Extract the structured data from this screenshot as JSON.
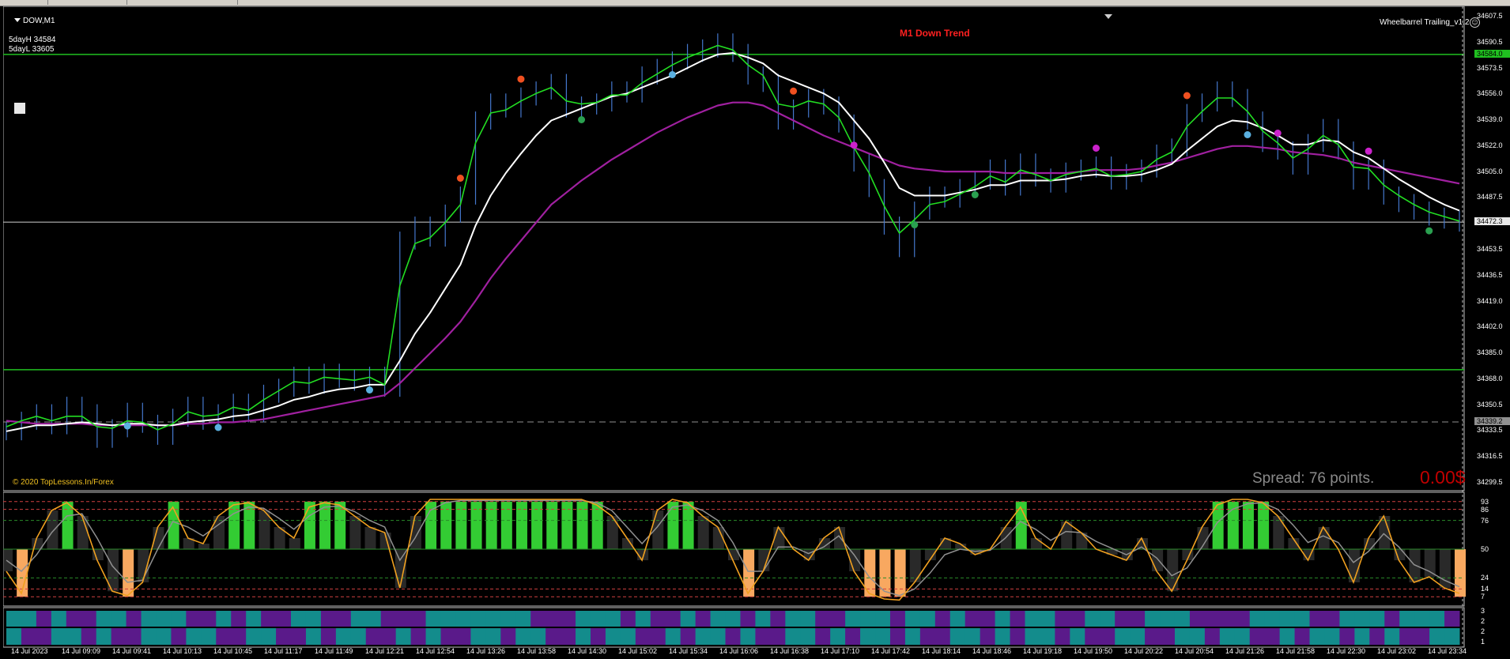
{
  "window": {
    "symbol_label": "DOW,M1",
    "five_day_high": "5dayH 34584",
    "five_day_low": "5dayL 33605",
    "trend_label": "M1 Down Trend",
    "indicator_name": "Wheelbarrel Trailing_v1.2",
    "copyright": "© 2020 TopLessons.In/Forex",
    "spread_text": "Spread: 76 points.",
    "profit_text": "0.00$"
  },
  "colors": {
    "background": "#000000",
    "ema_fast": "#22dd22",
    "ema_mid": "#ffffff",
    "ema_slow": "#a020a0",
    "price_bars": "#4477cc",
    "level_line": "#20c020",
    "osc_line": "#f0a020",
    "osc_fill_high": "#33cc33",
    "osc_fill_low": "#f8a860",
    "hist_teal": "#138c8c",
    "hist_purple": "#5a1a8a"
  },
  "price_axis": {
    "labels": [
      "34607.5",
      "34590.5",
      "34573.5",
      "34556.0",
      "34539.0",
      "34522.0",
      "34505.0",
      "34487.5",
      "34470.5",
      "34453.5",
      "34436.5",
      "34419.0",
      "34402.0",
      "34385.0",
      "34368.0",
      "34350.5",
      "34333.5",
      "34316.5",
      "34299.5"
    ],
    "box_labels": [
      {
        "text": "34584.0",
        "color": "#20c020",
        "value": 34584
      },
      {
        "text": "34472.3",
        "color": "#e8e8e8",
        "value": 34472.3
      },
      {
        "text": "34339.2",
        "color": "#909090",
        "value": 34339.2
      }
    ]
  },
  "oscillator_axis": {
    "labels": [
      "93",
      "86",
      "76",
      "50",
      "24",
      "14",
      "7"
    ],
    "levels": [
      93,
      86,
      76,
      50,
      24,
      14,
      7
    ]
  },
  "histogram_axis": {
    "labels": [
      "3",
      "2",
      "2",
      "1"
    ]
  },
  "time_axis": {
    "labels": [
      "14 Jul 2023",
      "14 Jul 09:09",
      "14 Jul 09:41",
      "14 Jul 10:13",
      "14 Jul 10:45",
      "14 Jul 11:17",
      "14 Jul 11:49",
      "14 Jul 12:21",
      "14 Jul 12:54",
      "14 Jul 13:26",
      "14 Jul 13:58",
      "14 Jul 14:30",
      "14 Jul 15:02",
      "14 Jul 15:34",
      "14 Jul 16:06",
      "14 Jul 16:38",
      "14 Jul 17:10",
      "14 Jul 17:42",
      "14 Jul 18:14",
      "14 Jul 18:46",
      "14 Jul 19:18",
      "14 Jul 19:50",
      "14 Jul 20:22",
      "14 Jul 20:54",
      "14 Jul 21:26",
      "14 Jul 21:58",
      "14 Jul 22:30",
      "14 Jul 23:02",
      "14 Jul 23:34"
    ]
  },
  "levels": {
    "five_day_high": 34584,
    "current_price": 34472.3,
    "breakout_level": 34374,
    "dashed_level": 34339.2
  },
  "series": {
    "price_close": [
      34333,
      34340,
      34345,
      34337,
      34350,
      34345,
      34328,
      34335,
      34346,
      34338,
      34330,
      34342,
      34350,
      34340,
      34345,
      34352,
      34345,
      34358,
      34362,
      34370,
      34364,
      34372,
      34368,
      34366,
      34370,
      34362,
      34460,
      34470,
      34462,
      34478,
      34490,
      34540,
      34552,
      34548,
      34556,
      34560,
      34565,
      34548,
      34550,
      34552,
      34560,
      34558,
      34570,
      34575,
      34580,
      34585,
      34588,
      34592,
      34585,
      34570,
      34565,
      34540,
      34548,
      34555,
      34550,
      34538,
      34512,
      34495,
      34470,
      34455,
      34480,
      34490,
      34488,
      34495,
      34500,
      34508,
      34496,
      34512,
      34502,
      34498,
      34506,
      34508,
      34510,
      34500,
      34505,
      34508,
      34518,
      34522,
      34545,
      34552,
      34560,
      34555,
      34540,
      34525,
      34520,
      34510,
      34525,
      34535,
      34520,
      34500,
      34508,
      34490,
      34485,
      34480,
      34476,
      34474,
      34472
    ],
    "ema_fast": [
      34336,
      34340,
      34343,
      34340,
      34343,
      34343,
      34336,
      34335,
      34340,
      34339,
      34334,
      34338,
      34346,
      34343,
      34344,
      34349,
      34347,
      34354,
      34360,
      34366,
      34365,
      34369,
      34368,
      34367,
      34369,
      34364,
      34430,
      34458,
      34462,
      34472,
      34484,
      34525,
      34545,
      34547,
      34553,
      34558,
      34562,
      34553,
      34551,
      34552,
      34557,
      34557,
      34565,
      34571,
      34577,
      34582,
      34586,
      34590,
      34587,
      34577,
      34570,
      34551,
      34549,
      34553,
      34551,
      34542,
      34522,
      34505,
      34483,
      34465,
      34474,
      34484,
      34486,
      34491,
      34496,
      34503,
      34499,
      34507,
      34504,
      34500,
      34504,
      34506,
      34508,
      34503,
      34504,
      34506,
      34514,
      34519,
      34536,
      34546,
      34555,
      34555,
      34546,
      34533,
      34525,
      34515,
      34521,
      34530,
      34524,
      34509,
      34508,
      34497,
      34490,
      34484,
      34479,
      34476,
      34473
    ],
    "ema_mid": [
      34333,
      34335,
      34337,
      34337,
      34338,
      34339,
      34338,
      34337,
      34338,
      34338,
      34337,
      34337,
      34339,
      34340,
      34341,
      34343,
      34344,
      34347,
      34350,
      34354,
      34356,
      34359,
      34361,
      34362,
      34364,
      34364,
      34380,
      34398,
      34412,
      34428,
      34444,
      34470,
      34490,
      34505,
      34518,
      34530,
      34540,
      34544,
      34548,
      34552,
      34556,
      34558,
      34562,
      34566,
      34570,
      34575,
      34580,
      34584,
      34585,
      34582,
      34578,
      34570,
      34566,
      34562,
      34558,
      34552,
      34540,
      34528,
      34512,
      34495,
      34490,
      34490,
      34490,
      34492,
      34494,
      34497,
      34497,
      34500,
      34500,
      34500,
      34501,
      34503,
      34504,
      34503,
      34503,
      34504,
      34507,
      34511,
      34520,
      34528,
      34536,
      34540,
      34539,
      34535,
      34530,
      34524,
      34524,
      34527,
      34526,
      34519,
      34515,
      34508,
      34501,
      34495,
      34489,
      34484,
      34480
    ],
    "ema_slow": [
      34340,
      34339,
      34338,
      34338,
      34338,
      34338,
      34337,
      34337,
      34337,
      34337,
      34337,
      34337,
      34338,
      34338,
      34339,
      34339,
      34340,
      34341,
      34343,
      34345,
      34347,
      34349,
      34351,
      34353,
      34355,
      34357,
      34365,
      34375,
      34385,
      34395,
      34406,
      34420,
      34435,
      34448,
      34460,
      34472,
      34484,
      34492,
      34500,
      34507,
      34514,
      34520,
      34526,
      34532,
      34537,
      34542,
      34546,
      34550,
      34552,
      34552,
      34550,
      34545,
      34540,
      34535,
      34530,
      34526,
      34522,
      34518,
      34514,
      34510,
      34508,
      34507,
      34506,
      34506,
      34506,
      34506,
      34505,
      34505,
      34505,
      34505,
      34505,
      34506,
      34507,
      34507,
      34507,
      34508,
      34510,
      34512,
      34515,
      34518,
      34521,
      34523,
      34523,
      34522,
      34521,
      34519,
      34518,
      34517,
      34515,
      34512,
      34510,
      34508,
      34506,
      34504,
      34502,
      34500,
      34498
    ],
    "oscillator": [
      30,
      10,
      60,
      85,
      92,
      80,
      40,
      12,
      8,
      20,
      70,
      88,
      60,
      55,
      80,
      90,
      92,
      85,
      70,
      60,
      88,
      92,
      90,
      80,
      70,
      65,
      15,
      80,
      95,
      95,
      95,
      95,
      95,
      95,
      95,
      95,
      95,
      95,
      95,
      90,
      80,
      60,
      40,
      85,
      95,
      92,
      80,
      70,
      40,
      10,
      30,
      70,
      50,
      40,
      60,
      70,
      30,
      10,
      5,
      4,
      20,
      40,
      60,
      55,
      45,
      50,
      70,
      88,
      60,
      50,
      75,
      65,
      50,
      45,
      40,
      60,
      30,
      12,
      40,
      70,
      90,
      95,
      95,
      92,
      80,
      60,
      40,
      70,
      50,
      20,
      60,
      80,
      40,
      20,
      25,
      15,
      10
    ],
    "oscillator_signal": [
      40,
      30,
      45,
      65,
      80,
      82,
      60,
      35,
      20,
      22,
      50,
      75,
      70,
      62,
      72,
      82,
      88,
      87,
      78,
      68,
      80,
      88,
      89,
      84,
      76,
      70,
      40,
      60,
      85,
      92,
      94,
      94,
      94,
      94,
      94,
      94,
      94,
      94,
      94,
      92,
      85,
      70,
      55,
      70,
      88,
      90,
      85,
      76,
      56,
      30,
      30,
      52,
      52,
      46,
      52,
      62,
      45,
      25,
      12,
      8,
      14,
      28,
      45,
      50,
      48,
      49,
      60,
      75,
      68,
      58,
      66,
      65,
      57,
      51,
      45,
      52,
      42,
      26,
      33,
      52,
      74,
      86,
      91,
      92,
      86,
      72,
      56,
      62,
      56,
      38,
      48,
      64,
      52,
      36,
      30,
      22,
      16
    ],
    "histogram_top": [
      1,
      1,
      0,
      1,
      0,
      0,
      1,
      1,
      0,
      1,
      1,
      1,
      0,
      0,
      1,
      0,
      1,
      0,
      0,
      1,
      1,
      0,
      0,
      1,
      1,
      0,
      0,
      0,
      1,
      1,
      1,
      1,
      1,
      1,
      1,
      0,
      0,
      0,
      1,
      1,
      1,
      0,
      1,
      0,
      0,
      1,
      0,
      1,
      1,
      0,
      1,
      0,
      1,
      1,
      0,
      0,
      1,
      1,
      1,
      0,
      1,
      1,
      0,
      1,
      0,
      0,
      1,
      0,
      1,
      1,
      0,
      0,
      1,
      1,
      0,
      0,
      1,
      1,
      1,
      0,
      0,
      0,
      0,
      1,
      1,
      1,
      1,
      0,
      0,
      1,
      1,
      1,
      0,
      1,
      1,
      1,
      0
    ],
    "histogram_bottom": [
      1,
      0,
      0,
      1,
      1,
      0,
      1,
      0,
      0,
      1,
      1,
      0,
      1,
      1,
      0,
      0,
      1,
      1,
      0,
      0,
      1,
      0,
      1,
      1,
      0,
      0,
      1,
      0,
      1,
      0,
      0,
      1,
      1,
      0,
      1,
      1,
      0,
      0,
      1,
      0,
      1,
      1,
      0,
      0,
      1,
      0,
      1,
      1,
      0,
      1,
      0,
      0,
      1,
      1,
      0,
      1,
      0,
      1,
      1,
      0,
      1,
      0,
      0,
      1,
      1,
      0,
      1,
      0,
      1,
      1,
      0,
      1,
      0,
      0,
      1,
      1,
      0,
      0,
      1,
      1,
      0,
      1,
      1,
      0,
      0,
      1,
      0,
      1,
      1,
      0,
      1,
      0,
      1,
      0,
      0,
      1,
      1
    ]
  }
}
